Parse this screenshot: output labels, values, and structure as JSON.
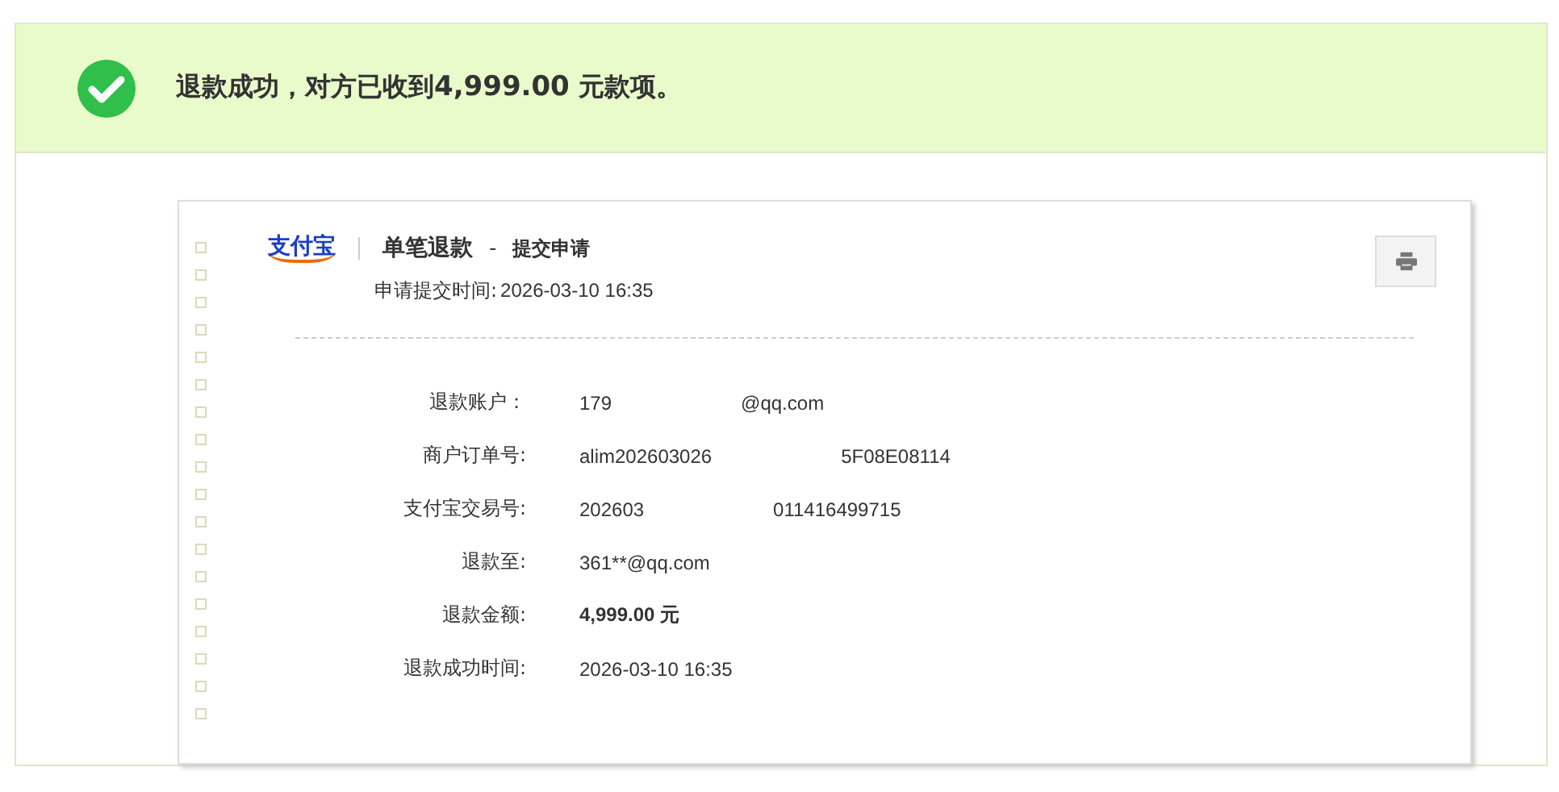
{
  "banner": {
    "message": "退款成功，对方已收到",
    "amount": "4,999.00",
    "suffix": "元款项。"
  },
  "receipt": {
    "logo": "支付宝",
    "title": "单笔退款",
    "separator": "-",
    "subtitle": "提交申请",
    "submit_time_label": "申请提交时间:",
    "submit_time": "2026-03-10 16:35",
    "rows": [
      {
        "label": "退款账户：",
        "parts": [
          "179",
          "@qq.com"
        ],
        "bold": false
      },
      {
        "label": "商户订单号:",
        "parts": [
          "alim202603026",
          "5F08E08114"
        ],
        "bold": false
      },
      {
        "label": "支付宝交易号:",
        "parts": [
          "202603",
          "011416499715"
        ],
        "bold": false
      },
      {
        "label": "退款至:",
        "parts": [
          "361**@qq.com"
        ],
        "bold": false
      },
      {
        "label": "退款金额:",
        "parts": [
          "4,999.00 元"
        ],
        "bold": true
      },
      {
        "label": "退款成功时间:",
        "parts": [
          "2026-03-10 16:35"
        ],
        "bold": false
      }
    ]
  }
}
